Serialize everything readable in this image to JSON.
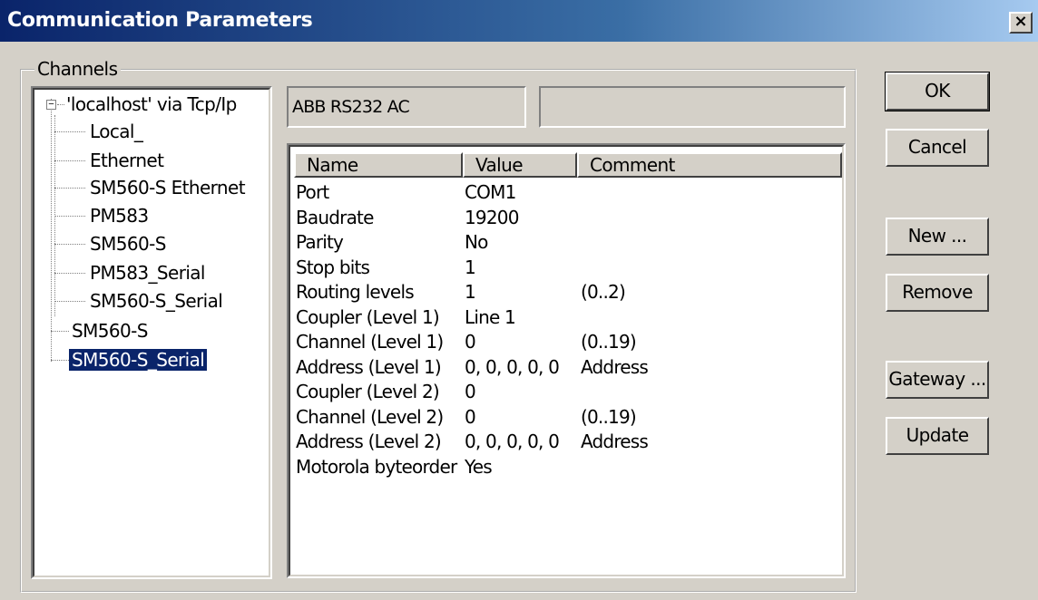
{
  "window": {
    "title": "Communication Parameters",
    "close_label": "×"
  },
  "channels": {
    "group_label": "Channels",
    "tree": {
      "root": "'localhost' via Tcp/Ip",
      "children": [
        "Local_",
        "Ethernet",
        "SM560-S Ethernet",
        "PM583",
        "SM560-S",
        "PM583_Serial",
        "SM560-S_Serial"
      ],
      "siblings": [
        "SM560-S",
        "SM560-S_Serial"
      ],
      "selected": "SM560-S_Serial"
    }
  },
  "driver": {
    "name": "ABB RS232 AC",
    "extra": ""
  },
  "params_table": {
    "columns": [
      "Name",
      "Value",
      "Comment"
    ],
    "rows": [
      {
        "name": "Port",
        "value": "COM1",
        "comment": ""
      },
      {
        "name": "Baudrate",
        "value": "19200",
        "comment": ""
      },
      {
        "name": "Parity",
        "value": "No",
        "comment": ""
      },
      {
        "name": "Stop bits",
        "value": "1",
        "comment": ""
      },
      {
        "name": "Routing levels",
        "value": "1",
        "comment": "(0..2)"
      },
      {
        "name": "Coupler (Level 1)",
        "value": "Line 1",
        "comment": ""
      },
      {
        "name": "Channel (Level 1)",
        "value": "0",
        "comment": "(0..19)"
      },
      {
        "name": "Address (Level 1)",
        "value": "0, 0, 0, 0, 0",
        "comment": "Address"
      },
      {
        "name": "Coupler (Level 2)",
        "value": "0",
        "comment": ""
      },
      {
        "name": "Channel (Level 2)",
        "value": "0",
        "comment": "(0..19)"
      },
      {
        "name": "Address (Level 2)",
        "value": "0, 0, 0, 0, 0",
        "comment": "Address"
      },
      {
        "name": "Motorola byteorder",
        "value": "Yes",
        "comment": ""
      }
    ]
  },
  "buttons": {
    "ok": "OK",
    "cancel": "Cancel",
    "new": "New ...",
    "remove": "Remove",
    "gateway": "Gateway ...",
    "update": "Update"
  }
}
